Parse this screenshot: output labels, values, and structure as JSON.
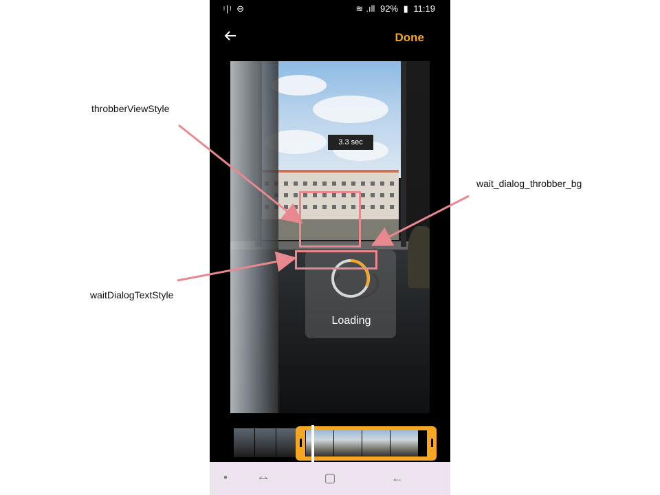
{
  "status_bar": {
    "left_icons": "ᵎ|ᵎ ⊖",
    "battery": "92%",
    "time": "11:19"
  },
  "toolbar": {
    "done_label": "Done"
  },
  "video": {
    "duration_badge": "3.3 sec"
  },
  "wait_dialog": {
    "text": "Loading"
  },
  "annotations": {
    "throbber_view": "throbberViewStyle",
    "throbber_bg": "wait_dialog_throbber_bg",
    "text_style": "waitDialogTextStyle"
  },
  "colors": {
    "accent": "#f5a623",
    "highlight": "#e8898f"
  },
  "icons": {
    "back": "back-arrow-icon",
    "nav_recents": "recents-icon",
    "nav_home": "home-icon",
    "nav_back": "nav-back-icon"
  }
}
